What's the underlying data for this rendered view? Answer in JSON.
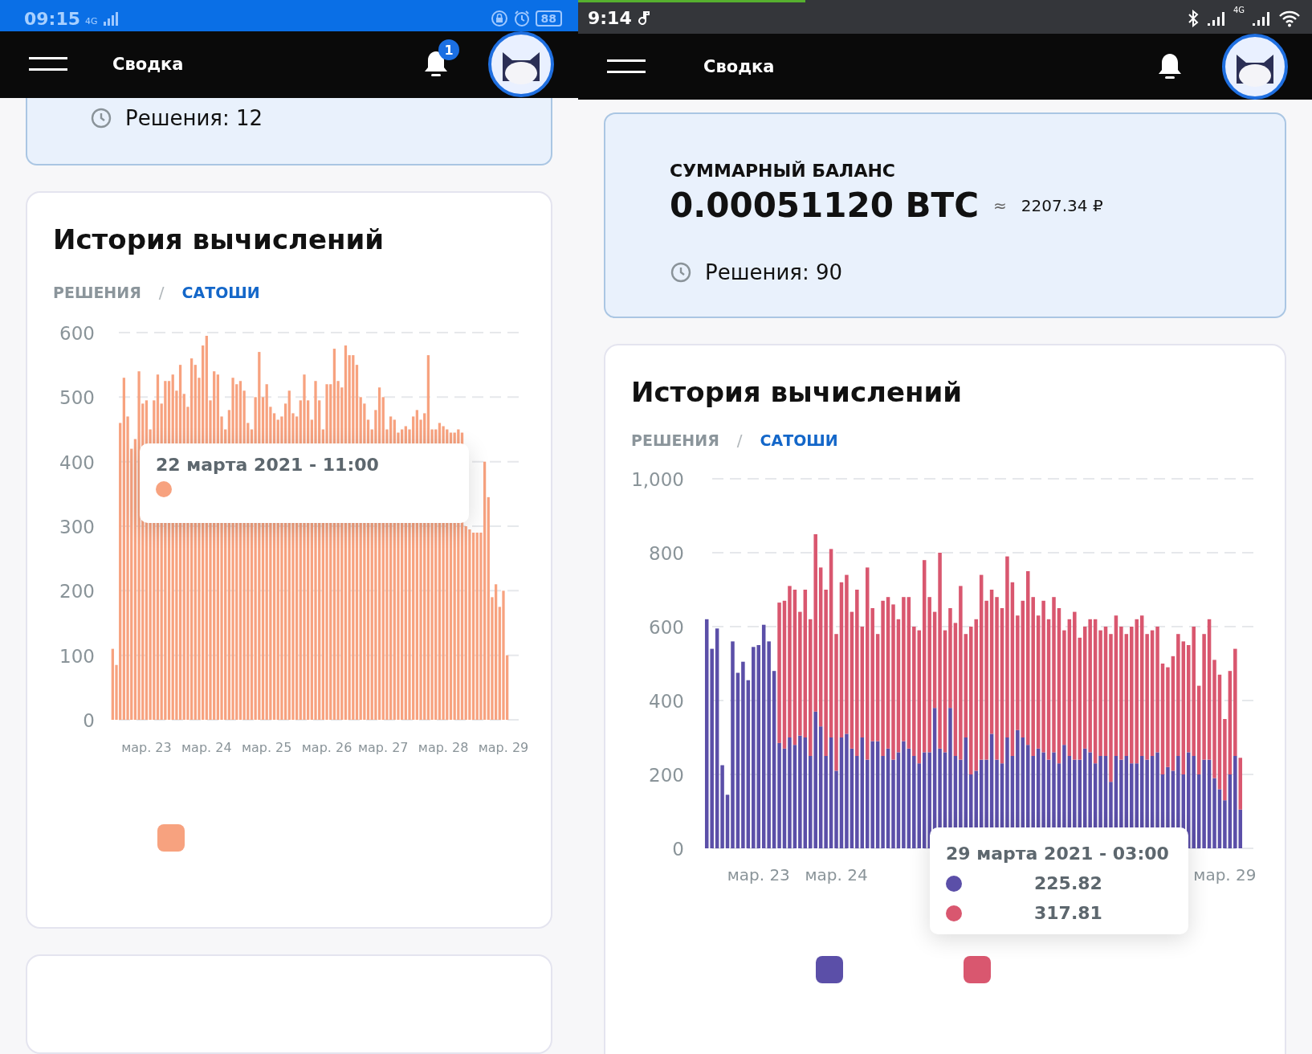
{
  "panels": [
    {
      "status_bar": {
        "kind": "blue",
        "time": "09:15",
        "network": "4G",
        "battery": "88"
      },
      "header": {
        "title": "Сводка",
        "notification_badge": "1"
      },
      "balance_card": {
        "solutions": "Решения: 12"
      },
      "history_card": {
        "title": "История вычислений",
        "separator": "/",
        "tabs": [
          {
            "label": "РЕШЕНИЯ",
            "selected": false
          },
          {
            "label": "САТОШИ",
            "selected": true
          }
        ],
        "chart_data": {
          "type": "bar",
          "grid": true,
          "ylim": [
            0,
            600
          ],
          "yticks": [
            0,
            100,
            200,
            300,
            400,
            500,
            600
          ],
          "categories": [
            null,
            null,
            null,
            null,
            null,
            null,
            null,
            null,
            null,
            "мар. 23",
            null,
            null,
            null,
            null,
            null,
            null,
            null,
            null,
            null,
            null,
            null,
            null,
            null,
            null,
            null,
            "мар. 24",
            null,
            null,
            null,
            null,
            null,
            null,
            null,
            null,
            null,
            null,
            null,
            null,
            null,
            null,
            null,
            "мар. 25",
            null,
            null,
            null,
            null,
            null,
            null,
            null,
            null,
            null,
            null,
            null,
            null,
            null,
            null,
            null,
            "мар. 26",
            null,
            null,
            null,
            null,
            null,
            null,
            null,
            null,
            null,
            null,
            null,
            null,
            null,
            null,
            "мар. 27",
            null,
            null,
            null,
            null,
            null,
            null,
            null,
            null,
            null,
            null,
            null,
            null,
            null,
            null,
            null,
            "мар. 28",
            null,
            null,
            null,
            null,
            null,
            null,
            null,
            null,
            null,
            null,
            null,
            null,
            null,
            null,
            null,
            "мар. 29",
            null
          ],
          "series": [
            {
              "color": "#f7a27f",
              "values": [
                110,
                85,
                460,
                530,
                470,
                420,
                435,
                540,
                490,
                495,
                450,
                495,
                535,
                490,
                525,
                525,
                535,
                510,
                550,
                505,
                485,
                560,
                550,
                530,
                580,
                595,
                495,
                540,
                535,
                470,
                450,
                480,
                530,
                520,
                525,
                510,
                460,
                450,
                500,
                570,
                500,
                520,
                485,
                475,
                465,
                470,
                490,
                510,
                475,
                470,
                495,
                535,
                495,
                465,
                525,
                495,
                450,
                520,
                520,
                575,
                525,
                515,
                580,
                565,
                565,
                550,
                500,
                490,
                465,
                450,
                480,
                515,
                500,
                450,
                470,
                465,
                445,
                450,
                455,
                450,
                470,
                480,
                465,
                475,
                565,
                450,
                450,
                460,
                455,
                450,
                445,
                445,
                450,
                445,
                300,
                295,
                290,
                290,
                290,
                400,
                345,
                190,
                210,
                175,
                200,
                100
              ]
            }
          ]
        },
        "tooltip": {
          "title": "22 марта 2021 - 11:00",
          "items": [
            {
              "color": "#f7a27f"
            }
          ]
        },
        "legend": [
          {
            "color": "#f7a27f"
          }
        ]
      }
    },
    {
      "status_bar": {
        "kind": "dark",
        "time": "9:14",
        "network": "4G",
        "load_progress": {
          "level": 0.31
        }
      },
      "header": {
        "title": "Сводка"
      },
      "balance_card": {
        "label": "СУММАРНЫЙ БАЛАНС",
        "amount": "0.00051120 BTC",
        "approx": "≈",
        "fiat": "2207.34 ₽",
        "solutions": "Решения: 90"
      },
      "history_card": {
        "title": "История вычислений",
        "separator": "/",
        "tabs": [
          {
            "label": "РЕШЕНИЯ",
            "selected": false
          },
          {
            "label": "САТОШИ",
            "selected": true
          }
        ],
        "chart_data": {
          "type": "bar",
          "stacked": true,
          "grid": true,
          "ylim": [
            0,
            1000
          ],
          "yticks": [
            0,
            200,
            400,
            600,
            800,
            {
              "value": 1000,
              "label": "1,000"
            }
          ],
          "categories": [
            null,
            null,
            null,
            null,
            null,
            null,
            null,
            null,
            null,
            null,
            "мар. 23",
            null,
            null,
            null,
            null,
            null,
            null,
            null,
            null,
            null,
            null,
            null,
            null,
            null,
            null,
            "мар. 24",
            null,
            null,
            null,
            null,
            null,
            null,
            null,
            null,
            null,
            null,
            null,
            null,
            null,
            null,
            null,
            null,
            null,
            null,
            null,
            null,
            null,
            null,
            null,
            null,
            null,
            null,
            null,
            null,
            null,
            null,
            null,
            null,
            null,
            null,
            null,
            null,
            null,
            null,
            null,
            null,
            null,
            null,
            null,
            null,
            null,
            null,
            null,
            null,
            null,
            null,
            null,
            null,
            null,
            null,
            null,
            null,
            null,
            null,
            null,
            null,
            null,
            null,
            null,
            null,
            null,
            null,
            null,
            null,
            null,
            null,
            null,
            null,
            null,
            null,
            "мар. 29",
            null,
            null,
            null
          ],
          "series": [
            {
              "color": "#5b4fa8",
              "values": [
                620,
                540,
                595,
                225,
                145,
                560,
                475,
                505,
                455,
                545,
                550,
                605,
                560,
                480,
                285,
                270,
                300,
                280,
                305,
                300,
                250,
                370,
                330,
                250,
                300,
                210,
                300,
                310,
                270,
                250,
                300,
                240,
                290,
                290,
                250,
                270,
                240,
                260,
                290,
                270,
                250,
                230,
                260,
                260,
                380,
                270,
                260,
                380,
                250,
                240,
                300,
                200,
                210,
                240,
                240,
                310,
                240,
                230,
                300,
                250,
                320,
                300,
                280,
                250,
                270,
                260,
                240,
                260,
                230,
                280,
                250,
                240,
                240,
                270,
                260,
                230,
                250,
                250,
                180,
                250,
                240,
                250,
                230,
                230,
                250,
                240,
                250,
                260,
                200,
                220,
                210,
                250,
                200,
                260,
                250,
                200,
                240,
                240,
                190,
                160,
                130,
                200,
                250,
                105
              ]
            },
            {
              "color": "#d9576f",
              "values": [
                0,
                0,
                0,
                0,
                0,
                0,
                0,
                0,
                0,
                0,
                0,
                0,
                0,
                0,
                380,
                400,
                410,
                420,
                335,
                400,
                370,
                480,
                430,
                450,
                510,
                370,
                420,
                430,
                370,
                450,
                300,
                520,
                360,
                290,
                420,
                410,
                420,
                360,
                390,
                410,
                350,
                360,
                520,
                420,
                260,
                530,
                330,
                270,
                360,
                470,
                280,
                400,
                410,
                500,
                430,
                390,
                440,
                420,
                490,
                470,
                310,
                370,
                470,
                430,
                360,
                410,
                380,
                420,
                420,
                310,
                370,
                400,
                330,
                330,
                360,
                390,
                340,
                350,
                400,
                380,
                360,
                330,
                370,
                390,
                380,
                340,
                340,
                340,
                300,
                270,
                310,
                330,
                360,
                290,
                350,
                240,
                340,
                380,
                320,
                310,
                220,
                280,
                290,
                140
              ]
            }
          ]
        },
        "tooltip": {
          "title": "29 марта 2021 - 03:00",
          "items": [
            {
              "color": "#5b4fa8",
              "value": "225.82"
            },
            {
              "color": "#d9576f",
              "value": "317.81"
            }
          ]
        },
        "legend": [
          {
            "color": "#5b4fa8"
          },
          {
            "color": "#d9576f"
          }
        ]
      }
    }
  ]
}
